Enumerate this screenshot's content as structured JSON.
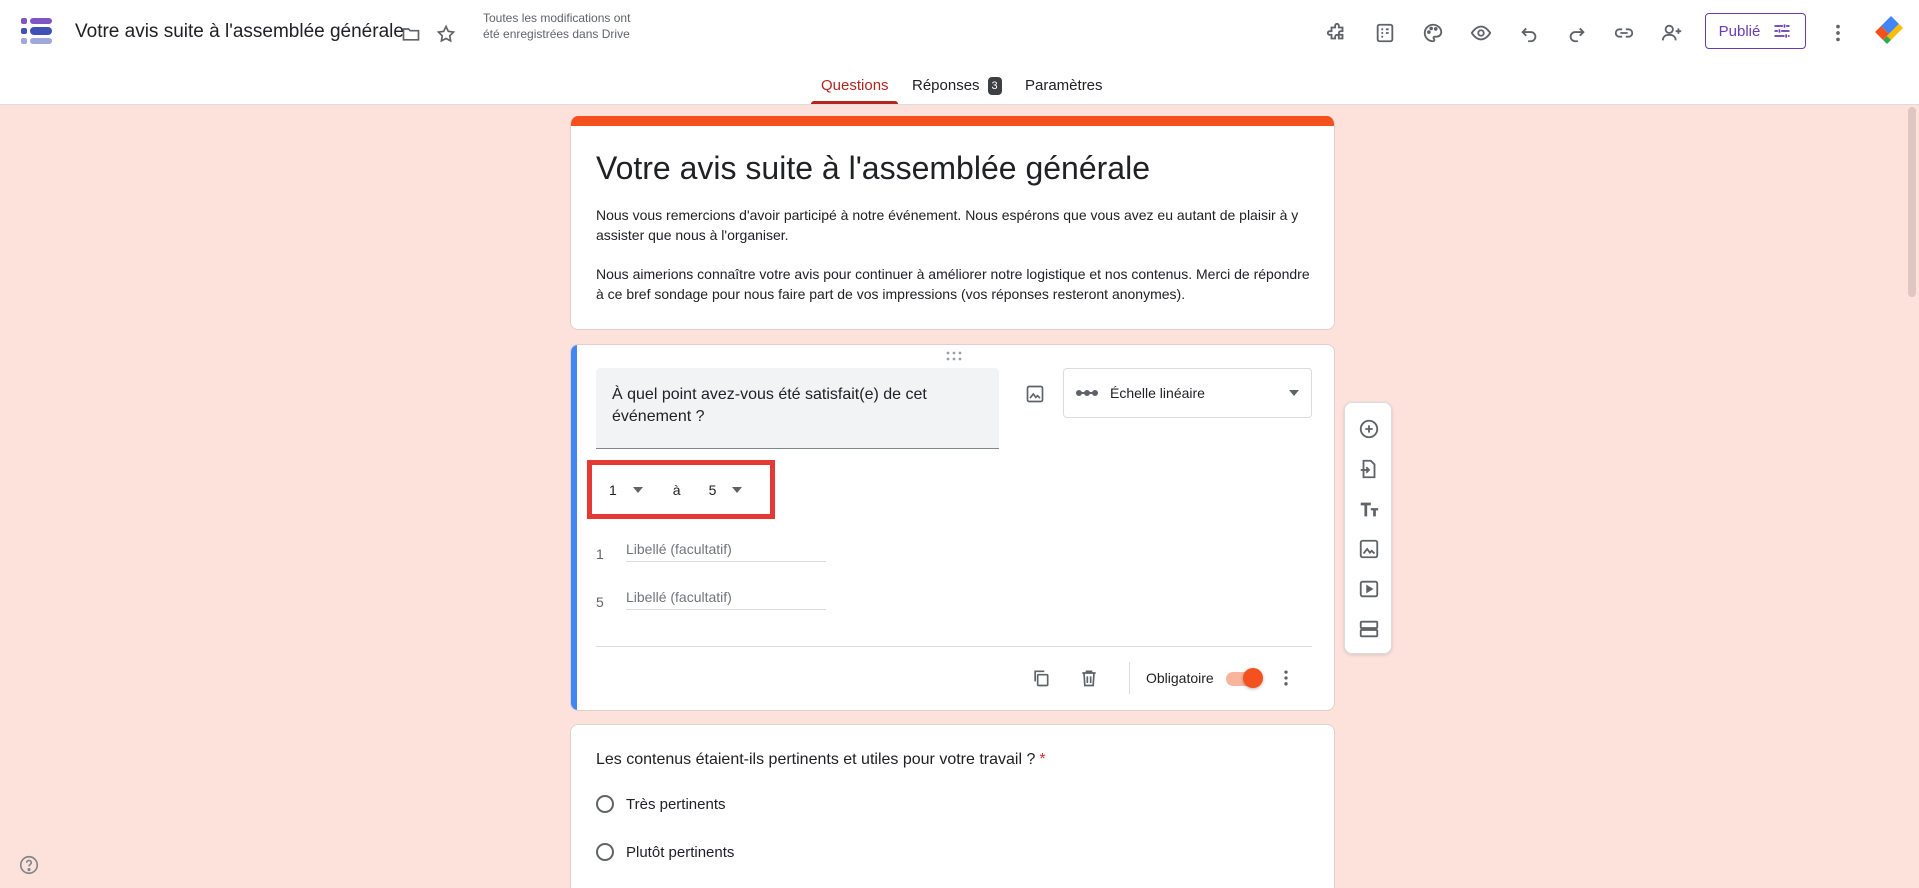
{
  "header": {
    "title": "Votre avis suite à l'assemblée générale",
    "save_status": "Toutes les modifications ont été enregistrées dans Drive",
    "publish_label": "Publié"
  },
  "tabs": {
    "questions": "Questions",
    "responses": "Réponses",
    "responses_count": "3",
    "settings": "Paramètres"
  },
  "form": {
    "title": "Votre avis suite à l'assemblée générale",
    "description_p1": "Nous vous remercions d'avoir participé à notre événement. Nous espérons que vous avez eu autant de plaisir à y assister que nous à l'organiser.",
    "description_p2": "Nous aimerions connaître votre avis pour continuer à améliorer notre logistique et nos contenus. Merci de répondre à ce bref sondage pour nous faire part de vos impressions (vos réponses resteront anonymes)."
  },
  "question1": {
    "text": "À quel point avez-vous été satisfait(e) de cet événement ?",
    "type": "Échelle linéaire",
    "scale_min": "1",
    "scale_sep": "à",
    "scale_max": "5",
    "label_min_num": "1",
    "label_max_num": "5",
    "label_placeholder": "Libellé (facultatif)",
    "required_label": "Obligatoire",
    "required": true
  },
  "question2": {
    "text": "Les contenus étaient-ils pertinents et utiles pour votre travail ?",
    "required_star": "*",
    "options": [
      "Très pertinents",
      "Plutôt pertinents"
    ]
  },
  "colors": {
    "accent": "#f4511e",
    "background": "#fde2dc",
    "active_question_bar": "#4285f4",
    "highlight_box": "#e53935",
    "brand_purple": "#673ab7"
  }
}
